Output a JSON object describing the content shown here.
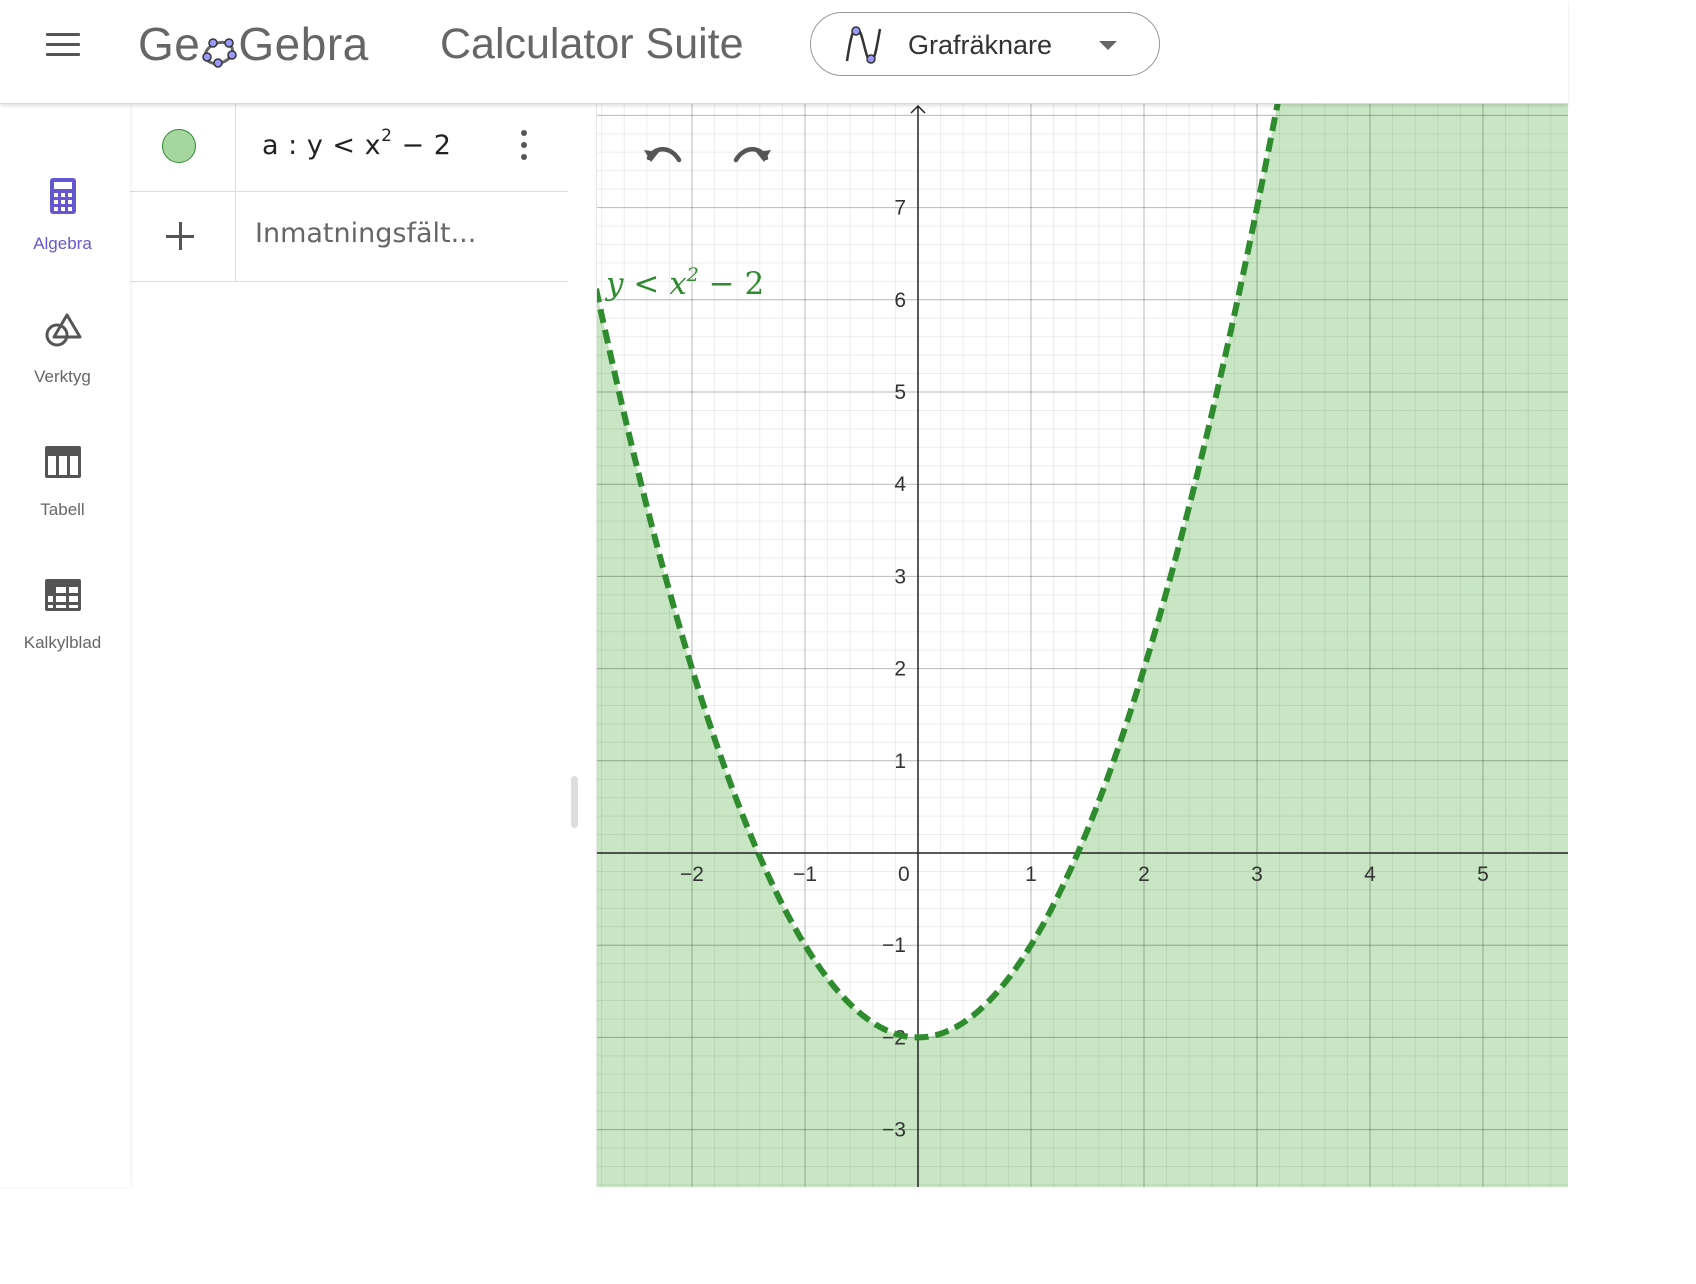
{
  "header": {
    "logo_text": "GeoGebra",
    "suite_title": "Calculator Suite",
    "app_switcher": {
      "label": "Grafräknare"
    }
  },
  "nav": {
    "items": [
      {
        "label": "Algebra",
        "icon": "calculator-icon",
        "active": true
      },
      {
        "label": "Verktyg",
        "icon": "shapes-icon",
        "active": false
      },
      {
        "label": "Tabell",
        "icon": "table-icon",
        "active": false
      },
      {
        "label": "Kalkylblad",
        "icon": "spreadsheet-icon",
        "active": false
      }
    ]
  },
  "algebra": {
    "entries": [
      {
        "name": "a",
        "separator": ":",
        "lhs": "y",
        "relation": "<",
        "base": "x",
        "exponent": "2",
        "rest": "− 2",
        "color": "#2e8b2e",
        "visible": true
      }
    ],
    "input_placeholder": "Inmatningsfält..."
  },
  "graphics": {
    "curve_label": {
      "lhs": "y",
      "relation": "<",
      "base": "x",
      "exponent": "2",
      "rest": "− 2"
    },
    "x_ticks": [
      "−2",
      "−1",
      "0",
      "1",
      "2",
      "3",
      "4",
      "5"
    ],
    "y_ticks": [
      "7",
      "6",
      "5",
      "4",
      "3",
      "2",
      "1",
      "−1",
      "−2",
      "−3"
    ],
    "fill_color": "#c8e6c3",
    "curve_color": "#2e8b2e"
  },
  "chart_data": {
    "type": "line",
    "title": "",
    "xlabel": "",
    "ylabel": "",
    "xlim": [
      -2.84,
      5.78
    ],
    "ylim": [
      -3.6,
      8.1
    ],
    "function": "y = x^2 - 2",
    "inequality": "y < x^2 - 2",
    "shaded": "below curve",
    "line_style": "dashed",
    "x": [
      -2.8,
      -2.5,
      -2,
      -1.5,
      -1,
      -0.5,
      0,
      0.5,
      1,
      1.5,
      2,
      2.5,
      3,
      3.17
    ],
    "y": [
      5.84,
      4.25,
      2,
      0.25,
      -1,
      -1.75,
      -2,
      -1.75,
      -1,
      0.25,
      2,
      4.25,
      7,
      8.05
    ],
    "grid": true
  }
}
